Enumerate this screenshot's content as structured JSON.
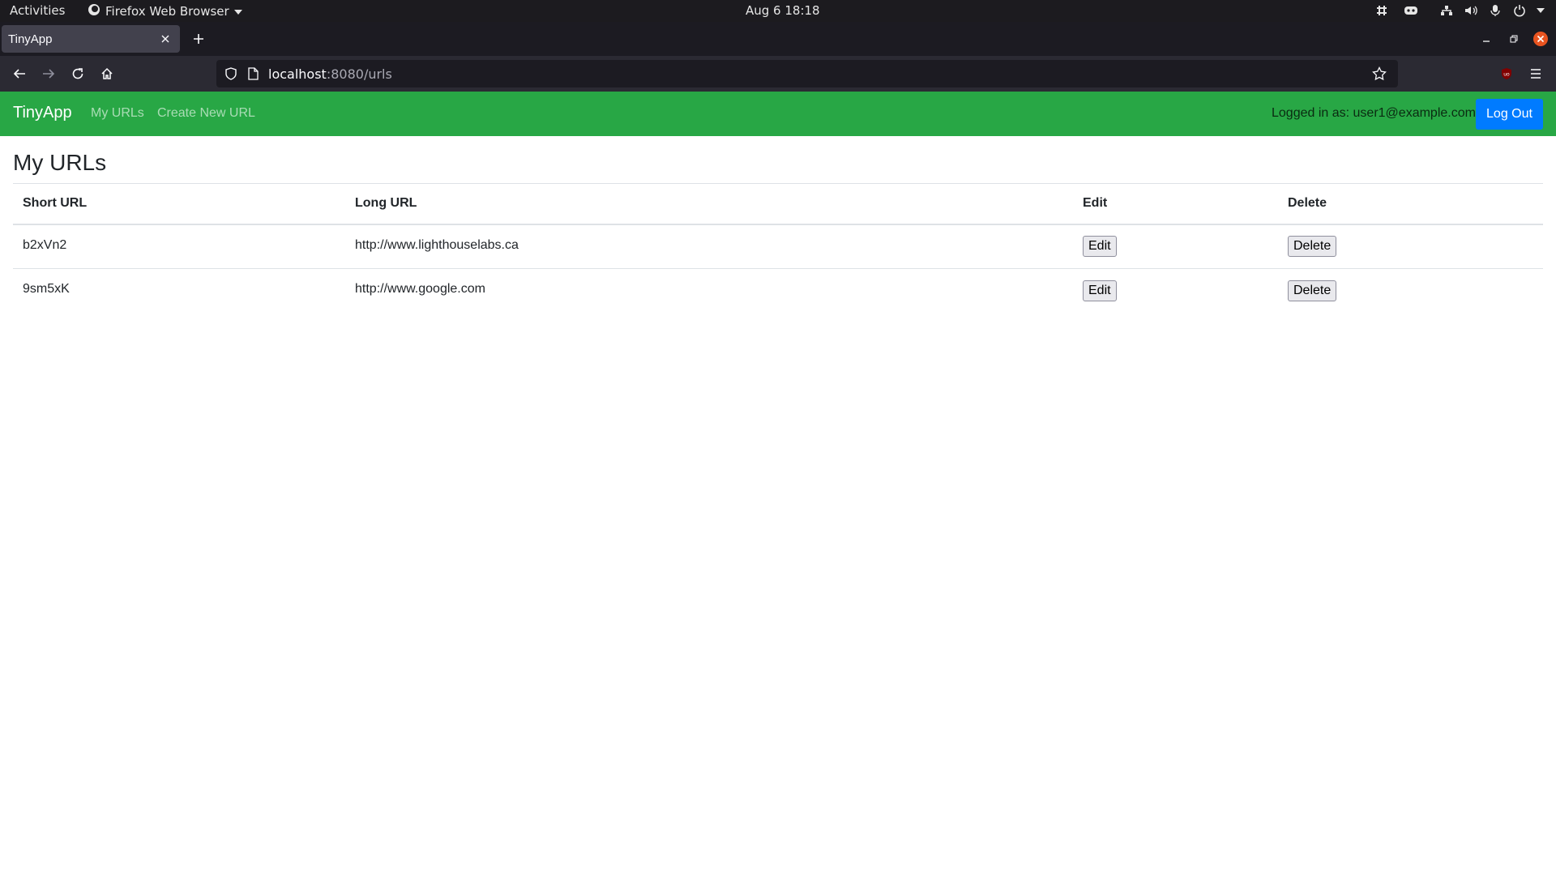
{
  "system_bar": {
    "activities": "Activities",
    "app_name": "Firefox Web Browser",
    "clock": "Aug 6  18:18"
  },
  "browser": {
    "tab_title": "TinyApp",
    "url_host": "localhost",
    "url_path": ":8080/urls"
  },
  "app": {
    "brand": "TinyApp",
    "nav_links": [
      "My URLs",
      "Create New URL"
    ],
    "logged_in_text": "Logged in as: user1@example.com",
    "logout_label": "Log Out",
    "page_title": "My URLs",
    "table": {
      "headers": [
        "Short URL",
        "Long URL",
        "Edit",
        "Delete"
      ],
      "rows": [
        {
          "short": "b2xVn2",
          "long": "http://www.lighthouselabs.ca",
          "edit": "Edit",
          "delete": "Delete"
        },
        {
          "short": "9sm5xK",
          "long": "http://www.google.com",
          "edit": "Edit",
          "delete": "Delete"
        }
      ]
    }
  },
  "colors": {
    "navbar_green": "#28a745",
    "logout_blue": "#007bff",
    "close_red": "#e95420"
  }
}
